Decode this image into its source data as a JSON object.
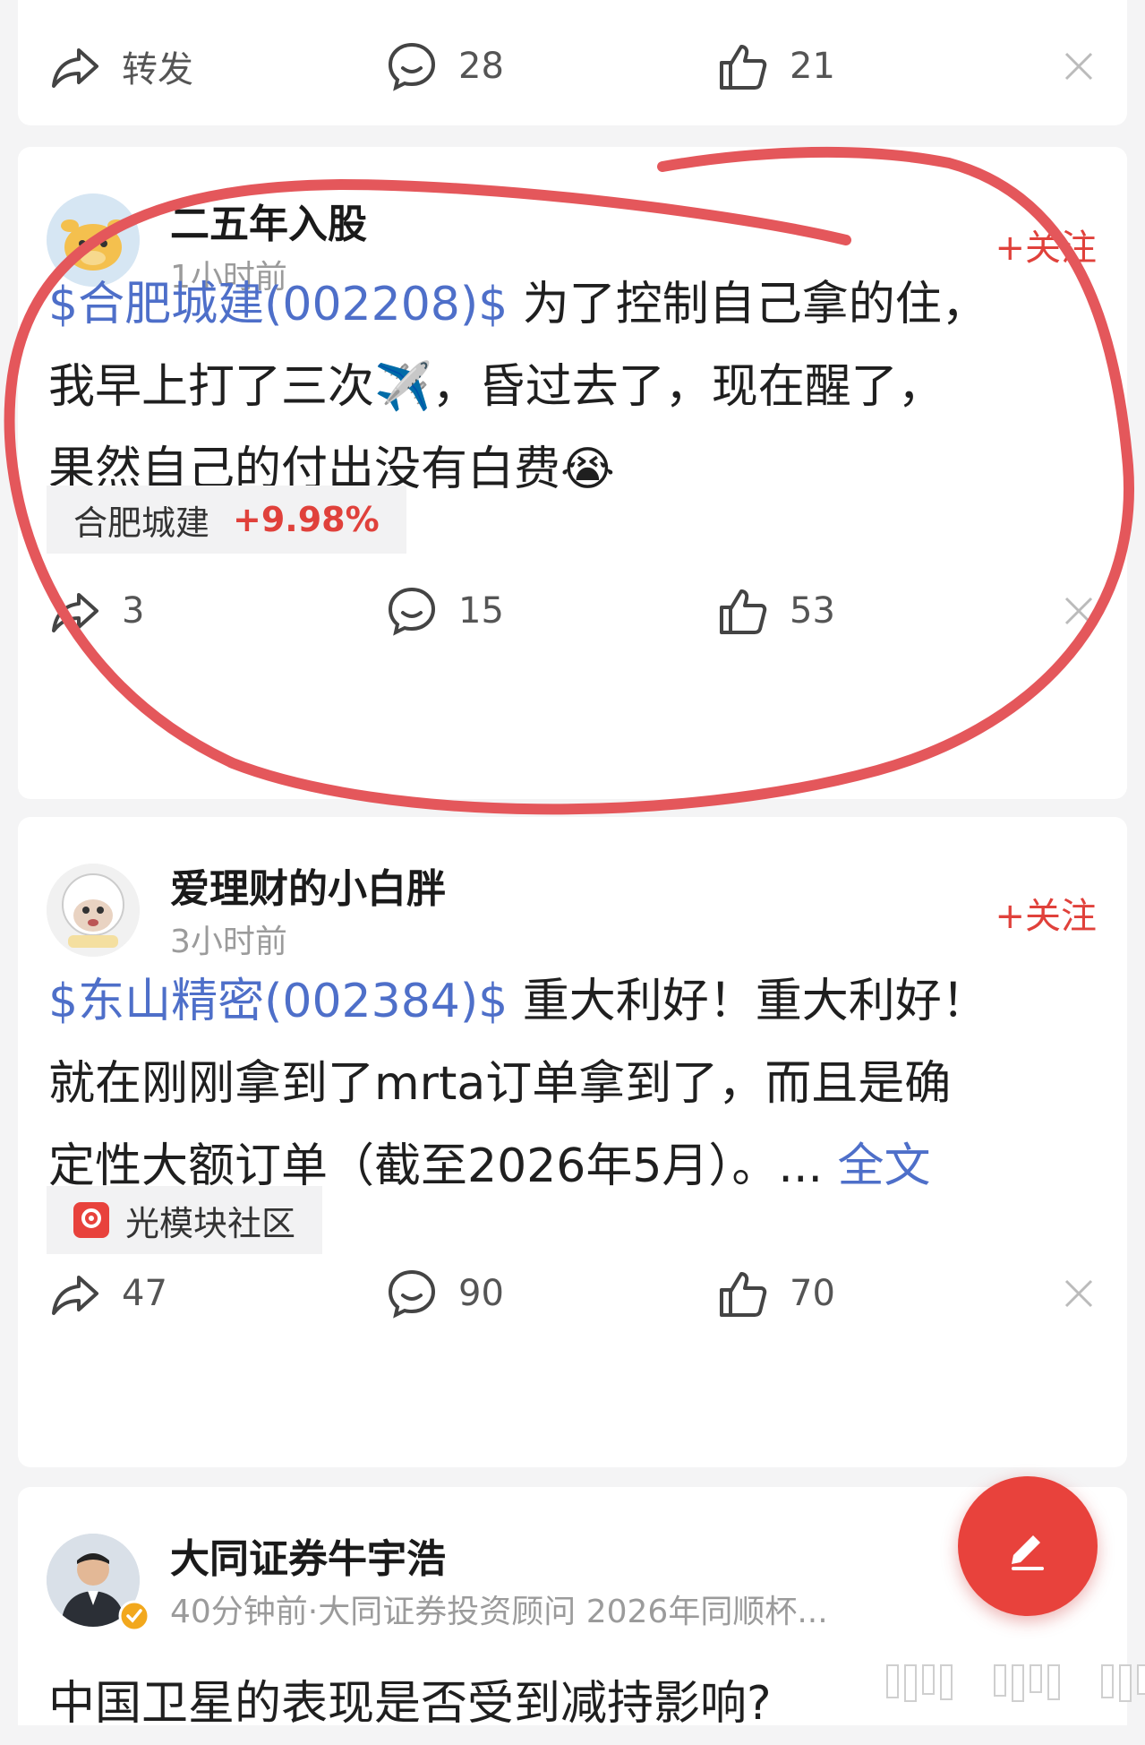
{
  "top_actions": {
    "share_label": "转发",
    "comments": "28",
    "likes": "21"
  },
  "post1": {
    "username": "二五年入股",
    "time": "1小时前",
    "follow": "+关注",
    "stock_link": "$合肥城建(002208)$",
    "line1": " 为了控制自己拿的住，",
    "line2": "我早上打了三次✈️，昏过去了，现在醒了，",
    "line3": "果然自己的付出没有白费😭",
    "tag_name": "合肥城建",
    "tag_pct": "+9.98%",
    "shares": "3",
    "comments": "15",
    "likes": "53"
  },
  "post2": {
    "username": "爱理财的小白胖",
    "time": "3小时前",
    "follow": "+关注",
    "stock_link": "$东山精密(002384)$",
    "line1": " 重大利好！重大利好！",
    "line2": "就在刚刚拿到了mrta订单拿到了，而且是确",
    "line3": "定性大额订单（截至2026年5月）。...",
    "more": "全文",
    "community": "光模块社区",
    "shares": "47",
    "comments": "90",
    "likes": "70"
  },
  "post3": {
    "username": "大同证券牛宇浩",
    "meta": "40分钟前·大同证券投资顾问 2026年同顺杯...",
    "title": "中国卫星的表现是否受到减持影响?"
  },
  "colors": {
    "accent": "#e0413b",
    "link": "#4e6fc9",
    "annotation": "#e4575b"
  },
  "icons": [
    "share-icon",
    "comment-icon",
    "like-icon",
    "close-icon",
    "edit-icon",
    "location-icon",
    "verified-icon"
  ]
}
